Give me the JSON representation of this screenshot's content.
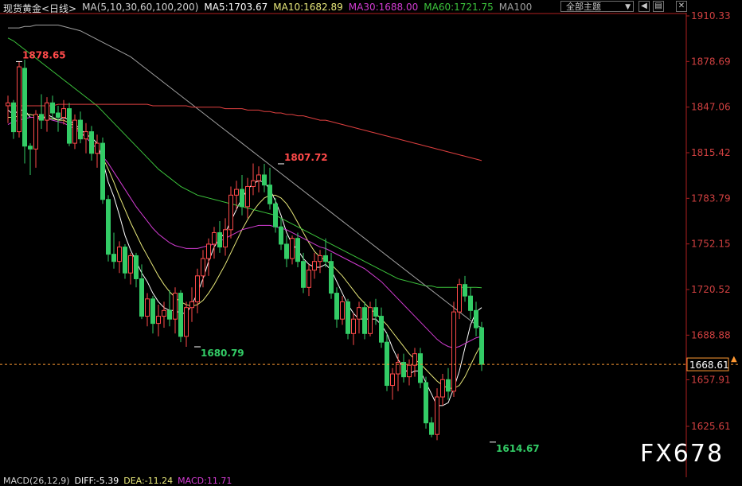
{
  "header": {
    "instrument": "现货黄金<日线>",
    "ma_params": "MA(5,10,30,60,100,200)",
    "ma5": "MA5:1703.67",
    "ma10": "MA10:1682.89",
    "ma30": "MA30:1688.00",
    "ma60": "MA60:1721.75",
    "ma100": "MA100",
    "theme_select": "全部主题",
    "theme_arrow": "▼",
    "btn_back": "◀",
    "btn_menu": "▤",
    "btn_close": "✕"
  },
  "footer": {
    "macd": "MACD(26,12,9)",
    "diff": "DIFF:-5.39",
    "dea": "DEA:-11.24",
    "macd_val": "MACD:11.71"
  },
  "watermark": "FX678",
  "colors": {
    "up": "#ff4a4a",
    "down": "#33cc66",
    "ma5": "#ffffff",
    "ma10": "#e8e87a",
    "ma30": "#d23cd2",
    "ma60": "#3cc43c",
    "ma100": "#a0a0a0",
    "ma200": "#e04040",
    "price_line": "#ff9933"
  },
  "chart_data": {
    "type": "candlestick",
    "y_axis_ticks": [
      1910.33,
      1878.69,
      1847.06,
      1815.42,
      1783.79,
      1752.15,
      1720.52,
      1688.88,
      1657.91,
      1625.61
    ],
    "current_price": 1668.61,
    "annotations": [
      {
        "text": "1878.65",
        "value": 1878.65,
        "index": 2,
        "color": "#ff4a4a"
      },
      {
        "text": "1807.72",
        "value": 1807.72,
        "index": 49,
        "color": "#ff4a4a"
      },
      {
        "text": "1680.79",
        "value": 1680.79,
        "index": 34,
        "color": "#33cc66"
      },
      {
        "text": "1614.67",
        "value": 1614.67,
        "index": 87,
        "color": "#33cc66"
      }
    ],
    "candles": [
      [
        1848,
        1855,
        1836,
        1850
      ],
      [
        1850,
        1852,
        1825,
        1830
      ],
      [
        1830,
        1878.65,
        1826,
        1875
      ],
      [
        1874,
        1880,
        1808,
        1820
      ],
      [
        1820,
        1822,
        1800,
        1818
      ],
      [
        1818,
        1845,
        1805,
        1842
      ],
      [
        1842,
        1856,
        1832,
        1838
      ],
      [
        1838,
        1854,
        1830,
        1850
      ],
      [
        1850,
        1855,
        1838,
        1843
      ],
      [
        1843,
        1848,
        1830,
        1840
      ],
      [
        1840,
        1852,
        1835,
        1846
      ],
      [
        1846,
        1850,
        1820,
        1822
      ],
      [
        1822,
        1842,
        1818,
        1838
      ],
      [
        1838,
        1844,
        1822,
        1825
      ],
      [
        1825,
        1836,
        1815,
        1830
      ],
      [
        1830,
        1834,
        1810,
        1815
      ],
      [
        1815,
        1828,
        1805,
        1822
      ],
      [
        1822,
        1826,
        1780,
        1783
      ],
      [
        1783,
        1786,
        1740,
        1745
      ],
      [
        1745,
        1760,
        1735,
        1740
      ],
      [
        1740,
        1754,
        1732,
        1750
      ],
      [
        1750,
        1752,
        1728,
        1732
      ],
      [
        1732,
        1746,
        1724,
        1744
      ],
      [
        1744,
        1746,
        1722,
        1728
      ],
      [
        1728,
        1738,
        1700,
        1702
      ],
      [
        1702,
        1718,
        1695,
        1714
      ],
      [
        1714,
        1716,
        1690,
        1697
      ],
      [
        1697,
        1710,
        1688,
        1702
      ],
      [
        1702,
        1712,
        1694,
        1706
      ],
      [
        1706,
        1720,
        1695,
        1700
      ],
      [
        1700,
        1722,
        1690,
        1718
      ],
      [
        1718,
        1720,
        1684,
        1688
      ],
      [
        1688,
        1712,
        1680.79,
        1708
      ],
      [
        1708,
        1722,
        1698,
        1712
      ],
      [
        1712,
        1735,
        1704,
        1730
      ],
      [
        1730,
        1748,
        1722,
        1742
      ],
      [
        1742,
        1756,
        1730,
        1752
      ],
      [
        1752,
        1764,
        1742,
        1760
      ],
      [
        1760,
        1768,
        1746,
        1750
      ],
      [
        1750,
        1770,
        1744,
        1762
      ],
      [
        1762,
        1792,
        1756,
        1786
      ],
      [
        1786,
        1796,
        1776,
        1790
      ],
      [
        1790,
        1800,
        1772,
        1778
      ],
      [
        1778,
        1798,
        1770,
        1792
      ],
      [
        1792,
        1808,
        1786,
        1796
      ],
      [
        1796,
        1806,
        1788,
        1800
      ],
      [
        1800,
        1807.72,
        1788,
        1793
      ],
      [
        1793,
        1805,
        1776,
        1780
      ],
      [
        1780,
        1784,
        1760,
        1764
      ],
      [
        1764,
        1770,
        1748,
        1752
      ],
      [
        1752,
        1758,
        1736,
        1742
      ],
      [
        1742,
        1758,
        1738,
        1756
      ],
      [
        1756,
        1760,
        1736,
        1740
      ],
      [
        1740,
        1746,
        1718,
        1722
      ],
      [
        1722,
        1738,
        1716,
        1734
      ],
      [
        1734,
        1746,
        1728,
        1740
      ],
      [
        1740,
        1748,
        1732,
        1744
      ],
      [
        1744,
        1756,
        1736,
        1740
      ],
      [
        1740,
        1746,
        1714,
        1718
      ],
      [
        1718,
        1722,
        1694,
        1700
      ],
      [
        1700,
        1716,
        1696,
        1712
      ],
      [
        1712,
        1714,
        1686,
        1690
      ],
      [
        1690,
        1704,
        1682,
        1700
      ],
      [
        1700,
        1712,
        1690,
        1708
      ],
      [
        1708,
        1712,
        1686,
        1690
      ],
      [
        1690,
        1712,
        1688,
        1708
      ],
      [
        1708,
        1714,
        1696,
        1702
      ],
      [
        1702,
        1708,
        1680,
        1684
      ],
      [
        1684,
        1690,
        1650,
        1654
      ],
      [
        1654,
        1666,
        1644,
        1662
      ],
      [
        1662,
        1676,
        1650,
        1670
      ],
      [
        1670,
        1676,
        1656,
        1660
      ],
      [
        1660,
        1672,
        1654,
        1668
      ],
      [
        1668,
        1680,
        1660,
        1676
      ],
      [
        1676,
        1680,
        1652,
        1656
      ],
      [
        1656,
        1660,
        1624,
        1628
      ],
      [
        1628,
        1632,
        1618,
        1620
      ],
      [
        1620,
        1652,
        1616,
        1646
      ],
      [
        1646,
        1662,
        1640,
        1658
      ],
      [
        1658,
        1666,
        1644,
        1650
      ],
      [
        1650,
        1712,
        1646,
        1705
      ],
      [
        1705,
        1728,
        1700,
        1724
      ],
      [
        1724,
        1730,
        1712,
        1716
      ],
      [
        1716,
        1722,
        1700,
        1706
      ],
      [
        1706,
        1712,
        1688,
        1694
      ],
      [
        1694,
        1698,
        1664,
        1668.61
      ]
    ],
    "ma_series": {
      "MA5": [
        1845,
        1842,
        1845,
        1845,
        1840,
        1840,
        1838,
        1842,
        1840,
        1838,
        1840,
        1838,
        1835,
        1832,
        1828,
        1826,
        1822,
        1810,
        1795,
        1785,
        1772,
        1758,
        1748,
        1740,
        1732,
        1726,
        1718,
        1712,
        1708,
        1706,
        1706,
        1704,
        1704,
        1710,
        1718,
        1728,
        1740,
        1750,
        1756,
        1760,
        1768,
        1776,
        1784,
        1790,
        1794,
        1796,
        1795,
        1790,
        1782,
        1772,
        1760,
        1752,
        1748,
        1742,
        1738,
        1736,
        1736,
        1738,
        1734,
        1726,
        1718,
        1710,
        1704,
        1700,
        1700,
        1700,
        1700,
        1696,
        1690,
        1680,
        1672,
        1666,
        1662,
        1664,
        1664,
        1656,
        1648,
        1640,
        1640,
        1642,
        1652,
        1664,
        1680,
        1696,
        1705,
        1708
      ],
      "MA10": [
        1840,
        1840,
        1841,
        1842,
        1842,
        1841,
        1840,
        1840,
        1839,
        1838,
        1838,
        1836,
        1834,
        1830,
        1826,
        1822,
        1818,
        1812,
        1804,
        1795,
        1785,
        1776,
        1767,
        1759,
        1751,
        1744,
        1737,
        1730,
        1724,
        1719,
        1715,
        1712,
        1710,
        1709,
        1710,
        1713,
        1718,
        1724,
        1731,
        1738,
        1746,
        1754,
        1762,
        1769,
        1775,
        1780,
        1784,
        1786,
        1786,
        1784,
        1780,
        1774,
        1767,
        1760,
        1753,
        1747,
        1743,
        1741,
        1738,
        1734,
        1730,
        1725,
        1720,
        1715,
        1711,
        1707,
        1704,
        1700,
        1696,
        1691,
        1686,
        1681,
        1676,
        1672,
        1669,
        1665,
        1661,
        1657,
        1654,
        1652,
        1652,
        1654,
        1660,
        1668,
        1676,
        1683
      ],
      "MA30": [
        1835,
        1837,
        1838,
        1839,
        1840,
        1840,
        1840,
        1839,
        1838,
        1837,
        1836,
        1834,
        1832,
        1829,
        1826,
        1822,
        1818,
        1813,
        1808,
        1802,
        1796,
        1790,
        1784,
        1778,
        1773,
        1768,
        1763,
        1759,
        1756,
        1753,
        1751,
        1750,
        1749,
        1749,
        1749,
        1750,
        1751,
        1752,
        1754,
        1756,
        1758,
        1760,
        1762,
        1763,
        1764,
        1765,
        1765,
        1765,
        1764,
        1763,
        1762,
        1760,
        1758,
        1756,
        1754,
        1752,
        1750,
        1749,
        1747,
        1745,
        1743,
        1741,
        1739,
        1737,
        1735,
        1732,
        1729,
        1726,
        1722,
        1718,
        1714,
        1710,
        1706,
        1702,
        1698,
        1694,
        1690,
        1686,
        1683,
        1681,
        1680,
        1681,
        1683,
        1685,
        1687,
        1688
      ],
      "MA60": [
        1895,
        1893,
        1890,
        1887,
        1884,
        1881,
        1878,
        1875,
        1872,
        1869,
        1866,
        1863,
        1860,
        1857,
        1854,
        1851,
        1848,
        1844,
        1840,
        1836,
        1832,
        1828,
        1824,
        1820,
        1816,
        1812,
        1808,
        1804,
        1801,
        1798,
        1795,
        1792,
        1790,
        1788,
        1786,
        1785,
        1784,
        1783,
        1782,
        1781,
        1780,
        1779,
        1778,
        1777,
        1776,
        1775,
        1774,
        1773,
        1772,
        1770,
        1768,
        1766,
        1764,
        1762,
        1760,
        1758,
        1756,
        1754,
        1752,
        1750,
        1748,
        1746,
        1744,
        1742,
        1740,
        1738,
        1736,
        1734,
        1732,
        1730,
        1728,
        1727,
        1726,
        1725,
        1724,
        1723,
        1723,
        1722,
        1722,
        1722,
        1722,
        1722,
        1722,
        1722,
        1722,
        1721.75
      ],
      "MA100": [
        1902,
        1902,
        1902,
        1903,
        1903,
        1904,
        1904,
        1904,
        1904,
        1904,
        1903,
        1902,
        1901,
        1900,
        1898,
        1896,
        1894,
        1892,
        1890,
        1888,
        1886,
        1884,
        1882,
        1879,
        1876,
        1873,
        1870,
        1867,
        1864,
        1861,
        1858,
        1855,
        1852,
        1849,
        1846,
        1843,
        1840,
        1837,
        1834,
        1831,
        1828,
        1825,
        1822,
        1819,
        1816,
        1813,
        1810,
        1807,
        1804,
        1801,
        1798,
        1795,
        1792,
        1789,
        1786,
        1783,
        1780,
        1777,
        1774,
        1771,
        1768,
        1765,
        1762,
        1759,
        1756,
        1753,
        1750,
        1747,
        1744,
        1741,
        1738,
        1735,
        1732,
        1729,
        1726,
        1723,
        1720,
        1717,
        1714,
        1711,
        1708,
        1705,
        1702,
        1699,
        1696,
        1694
      ],
      "MA200": [
        1848,
        1848,
        1848,
        1848,
        1848,
        1848,
        1848,
        1848,
        1848,
        1849,
        1849,
        1849,
        1849,
        1849,
        1849,
        1849,
        1849,
        1849,
        1849,
        1849,
        1849,
        1849,
        1849,
        1849,
        1849,
        1849,
        1848,
        1848,
        1848,
        1848,
        1848,
        1848,
        1848,
        1847,
        1847,
        1847,
        1847,
        1847,
        1847,
        1846,
        1846,
        1846,
        1846,
        1845,
        1845,
        1845,
        1844,
        1844,
        1843,
        1843,
        1842,
        1842,
        1841,
        1841,
        1840,
        1839,
        1838,
        1838,
        1837,
        1836,
        1835,
        1834,
        1833,
        1832,
        1831,
        1830,
        1829,
        1828,
        1827,
        1826,
        1825,
        1824,
        1823,
        1822,
        1821,
        1820,
        1819,
        1818,
        1817,
        1816,
        1815,
        1814,
        1813,
        1812,
        1811,
        1810
      ]
    }
  }
}
